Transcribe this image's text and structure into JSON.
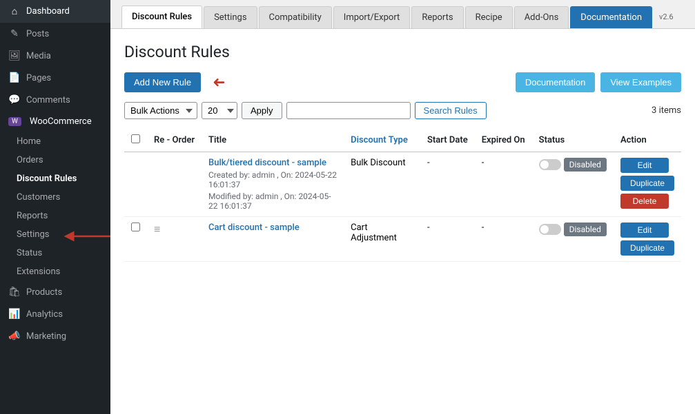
{
  "sidebar": {
    "items": [
      {
        "id": "dashboard",
        "label": "Dashboard",
        "icon": "⌂"
      },
      {
        "id": "posts",
        "label": "Posts",
        "icon": "✎"
      },
      {
        "id": "media",
        "label": "Media",
        "icon": "🖼"
      },
      {
        "id": "pages",
        "label": "Pages",
        "icon": "📄"
      },
      {
        "id": "comments",
        "label": "Comments",
        "icon": "💬"
      },
      {
        "id": "woocommerce",
        "label": "WooCommerce",
        "icon": "W",
        "woo": true
      },
      {
        "id": "home",
        "label": "Home",
        "sub": true
      },
      {
        "id": "orders",
        "label": "Orders",
        "sub": true
      },
      {
        "id": "discount-rules",
        "label": "Discount Rules",
        "sub": true,
        "active": true
      },
      {
        "id": "customers",
        "label": "Customers",
        "sub": true
      },
      {
        "id": "reports-woo",
        "label": "Reports",
        "sub": true
      },
      {
        "id": "settings-woo",
        "label": "Settings",
        "sub": true
      },
      {
        "id": "status",
        "label": "Status",
        "sub": true
      },
      {
        "id": "extensions",
        "label": "Extensions",
        "sub": true
      },
      {
        "id": "products",
        "label": "Products",
        "icon": "🛍"
      },
      {
        "id": "analytics",
        "label": "Analytics",
        "icon": "📊"
      },
      {
        "id": "marketing",
        "label": "Marketing",
        "icon": "📣"
      }
    ]
  },
  "tabs": [
    {
      "id": "discount-rules",
      "label": "Discount Rules",
      "active": true
    },
    {
      "id": "settings",
      "label": "Settings"
    },
    {
      "id": "compatibility",
      "label": "Compatibility"
    },
    {
      "id": "import-export",
      "label": "Import/Export"
    },
    {
      "id": "reports",
      "label": "Reports"
    },
    {
      "id": "recipe",
      "label": "Recipe"
    },
    {
      "id": "add-ons",
      "label": "Add-Ons"
    },
    {
      "id": "documentation",
      "label": "Documentation",
      "blue": true
    }
  ],
  "version": "v2.6",
  "page": {
    "title": "Discount Rules",
    "add_new_label": "Add New Rule",
    "documentation_label": "Documentation",
    "view_examples_label": "View Examples",
    "items_count": "3 items"
  },
  "filter": {
    "bulk_actions_label": "Bulk Actions",
    "per_page_value": "20",
    "apply_label": "Apply",
    "search_placeholder": "",
    "search_button_label": "Search Rules"
  },
  "table": {
    "columns": [
      {
        "id": "checkbox",
        "label": ""
      },
      {
        "id": "reorder",
        "label": "Re - Order"
      },
      {
        "id": "title",
        "label": "Title"
      },
      {
        "id": "discount-type",
        "label": "Discount Type"
      },
      {
        "id": "start-date",
        "label": "Start Date"
      },
      {
        "id": "expired-on",
        "label": "Expired On"
      },
      {
        "id": "status",
        "label": "Status"
      },
      {
        "id": "action",
        "label": "Action"
      }
    ],
    "rows": [
      {
        "id": 1,
        "title": "Bulk/tiered discount - sample",
        "discount_type": "Bulk Discount",
        "start_date": "-",
        "expired_on": "-",
        "status": "Disabled",
        "created_by": "admin",
        "created_on": "2024-05-22 16:01:37",
        "modified_by": "admin",
        "modified_on": "2024-05-22 16:01:37",
        "meta1": "Created by: admin , On: 2024-05-22 16:01:37",
        "meta2": "Modified by: admin , On: 2024-05-22 16:01:37"
      },
      {
        "id": 2,
        "title": "Cart discount - sample",
        "discount_type": "Cart Adjustment",
        "start_date": "-",
        "expired_on": "-",
        "status": "Disabled",
        "meta1": "",
        "meta2": ""
      }
    ],
    "action_labels": {
      "edit": "Edit",
      "duplicate": "Duplicate",
      "delete": "Delete"
    }
  }
}
